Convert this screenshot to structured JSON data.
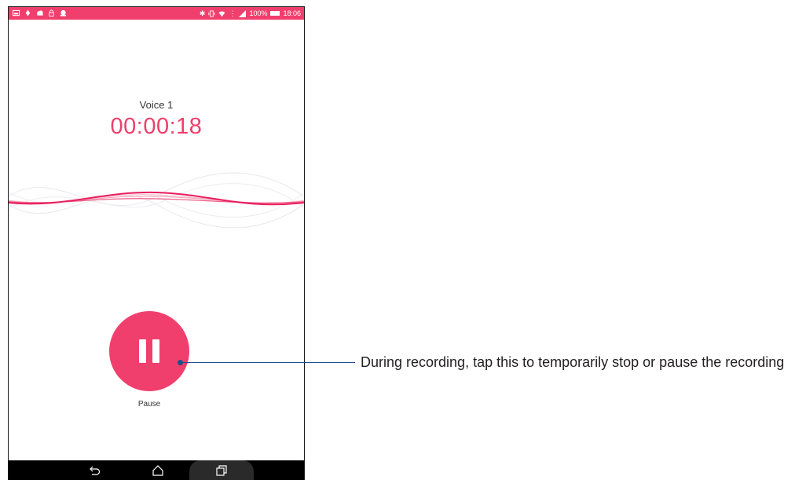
{
  "status_bar": {
    "left_icons": [
      "image-icon",
      "location-icon",
      "cloud-icon",
      "lock-icon",
      "app-icon"
    ],
    "right_icons": [
      "bluetooth-icon",
      "vibrate-icon",
      "wifi-icon",
      "signal-icon"
    ],
    "battery": "100%",
    "time": "18:06",
    "color": "#f13f6d"
  },
  "recording": {
    "name": "Voice 1",
    "elapsed": "00:00:18"
  },
  "controls": {
    "pause_label": "Pause"
  },
  "nav_bar": {
    "buttons": [
      "back-icon",
      "home-icon",
      "recent-apps-icon"
    ]
  },
  "annotation": {
    "text": "During recording, tap this to temporarily stop or pause the recording"
  },
  "colors": {
    "accent": "#f13f6d",
    "callout": "#1f4e8c"
  }
}
